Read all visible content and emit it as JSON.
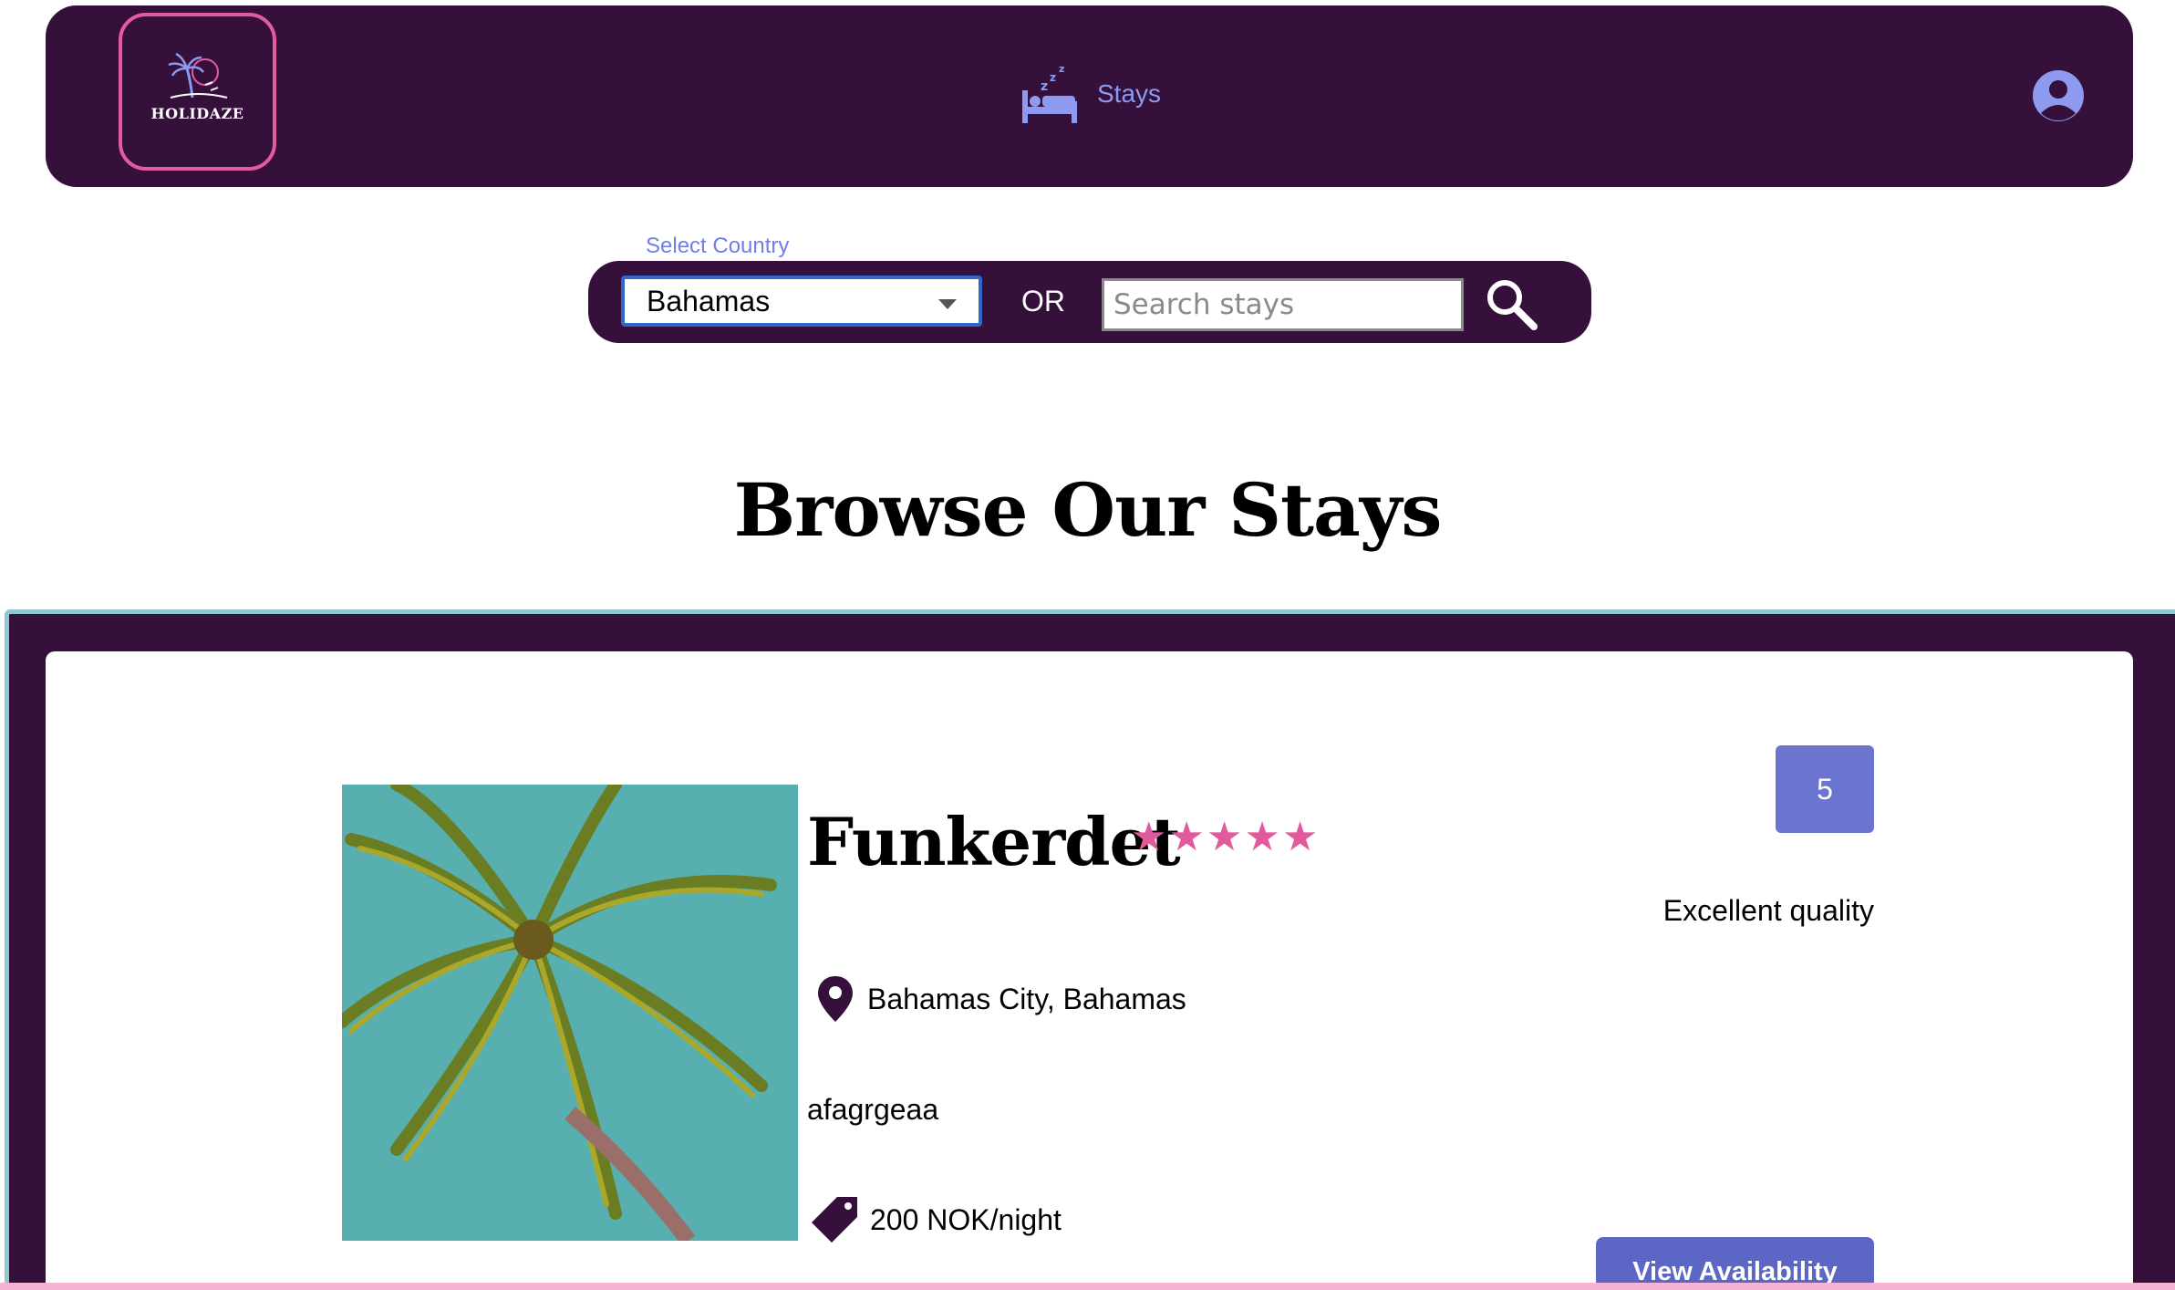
{
  "header": {
    "logo_text": "HOLIDAZE",
    "nav_stays_label": "Stays",
    "icons": [
      "palm-logo-icon",
      "bed-icon",
      "user-icon"
    ]
  },
  "search": {
    "country_label": "Select Country",
    "country_value": "Bahamas",
    "or_text": "OR",
    "placeholder": "Search stays"
  },
  "page": {
    "title": "Browse Our Stays"
  },
  "listing": {
    "name": "Funkerdet",
    "stars": 5,
    "rating_score": "5",
    "rating_text": "Excellent quality",
    "location": "Bahamas City, Bahamas",
    "description": "afagrgeaa",
    "price": "200 NOK/night",
    "view_button": "View Availability"
  },
  "colors": {
    "header_bg": "#35103a",
    "logo_border": "#e45c9f",
    "nav_accent": "#8d9af0",
    "star": "#e05a9c",
    "rating_badge": "#6b75d0",
    "button": "#5b66c5"
  }
}
